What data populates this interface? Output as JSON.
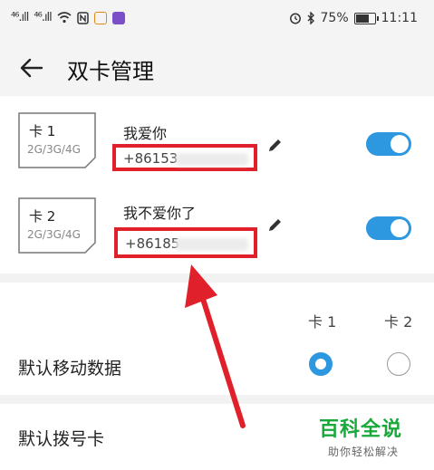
{
  "status_bar": {
    "signal1": "⁴⁶.ıll",
    "signal2": "⁴⁶.ıll",
    "battery": "75%",
    "time": "11:11",
    "battery_level": 0.75
  },
  "header": {
    "title": "双卡管理"
  },
  "sims": [
    {
      "slot_label": "卡 1",
      "network": "2G/3G/4G",
      "name": "我爱你",
      "number": "+86153",
      "enabled": true
    },
    {
      "slot_label": "卡 2",
      "network": "2G/3G/4G",
      "name": "我不爱你了",
      "number": "+86185",
      "enabled": true
    }
  ],
  "defaults": {
    "col1": "卡 1",
    "col2": "卡 2",
    "mobile_data_label": "默认移动数据",
    "mobile_data_selected": 1,
    "dial_label": "默认拨号卡"
  },
  "watermark": {
    "main": "百科全说",
    "sub": "助你轻松解决"
  },
  "colors": {
    "accent": "#2d97e0",
    "highlight": "#e0202a",
    "watermark": "#19a83a"
  }
}
